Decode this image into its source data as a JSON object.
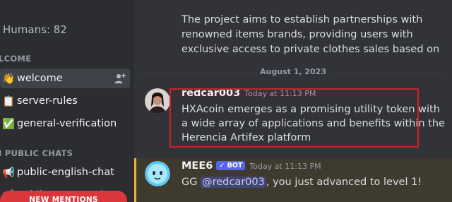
{
  "sidebar": {
    "humans": "Humans: 82",
    "category_welcome": "LCOME",
    "category_public": "I PUBLIC CHATS",
    "channels": [
      {
        "emoji": "👋",
        "label": "welcome"
      },
      {
        "emoji": "📋",
        "label": "server-rules"
      },
      {
        "emoji": "✅",
        "label": "general-verification"
      },
      {
        "emoji": "📢",
        "label": "public-english-chat"
      },
      {
        "emoji": "📢",
        "label": "public-german-chat"
      }
    ],
    "new_mentions": "NEW MENTIONS"
  },
  "chat": {
    "previous_message": "The project aims to establish partnerships with renowned items brands, providing users with exclusive access to private clothes sales based on",
    "date_divider": "August 1, 2023",
    "messages": [
      {
        "author": "redcar003",
        "timestamp": "Today at 11:13 PM",
        "text": "HXAcoin emerges as a promising utility token with a wide array of applications and benefits within the Herencia Artifex platform"
      },
      {
        "author": "MEE6",
        "bot_tag": "✓ BOT",
        "timestamp": "Today at 11:13 PM",
        "text_prefix": "GG ",
        "mention": "@redcar003",
        "text_suffix": ", you just advanced to level 1!"
      }
    ]
  },
  "colors": {
    "highlight_box": "#d21f26",
    "bot_tag": "#5865f2",
    "mention_bg": "#414675",
    "mentions_pill": "#da373c"
  }
}
